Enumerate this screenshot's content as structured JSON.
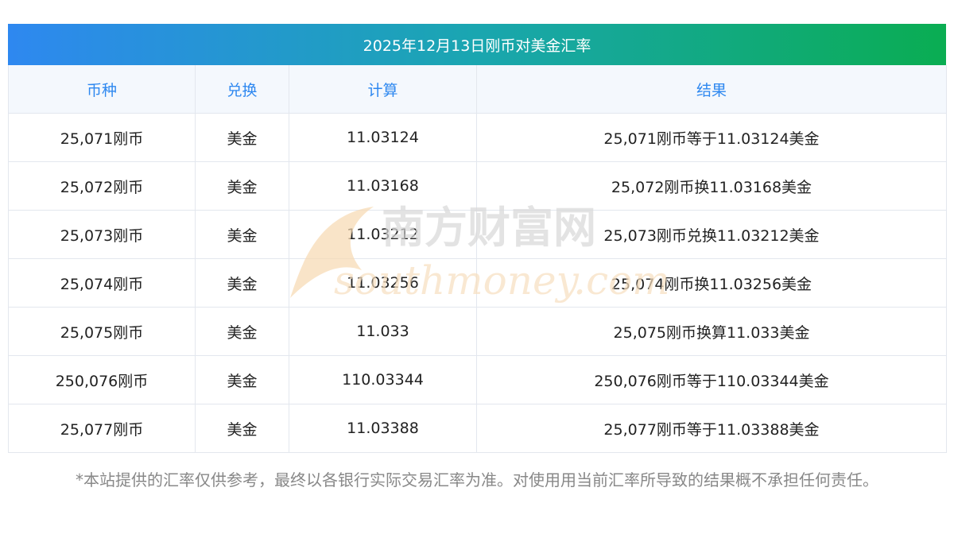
{
  "title": "2025年12月13日刚币对美金汇率",
  "columns": [
    "币种",
    "兑换",
    "计算",
    "结果"
  ],
  "rows": [
    {
      "currency": "25,071刚币",
      "target": "美金",
      "value": "11.03124",
      "result": "25,071刚币等于11.03124美金"
    },
    {
      "currency": "25,072刚币",
      "target": "美金",
      "value": "11.03168",
      "result": "25,072刚币换11.03168美金"
    },
    {
      "currency": "25,073刚币",
      "target": "美金",
      "value": "11.03212",
      "result": "25,073刚币兑换11.03212美金"
    },
    {
      "currency": "25,074刚币",
      "target": "美金",
      "value": "11.03256",
      "result": "25,074刚币换11.03256美金"
    },
    {
      "currency": "25,075刚币",
      "target": "美金",
      "value": "11.033",
      "result": "25,075刚币换算11.033美金"
    },
    {
      "currency": "250,076刚币",
      "target": "美金",
      "value": "110.03344",
      "result": "250,076刚币等于110.03344美金"
    },
    {
      "currency": "25,077刚币",
      "target": "美金",
      "value": "11.03388",
      "result": "25,077刚币等于11.03388美金"
    }
  ],
  "disclaimer": "*本站提供的汇率仅供参考，最终以各银行实际交易汇率为准。对使用用当前汇率所导致的结果概不承担任何责任。",
  "watermark": {
    "cn": "南方财富网",
    "en": "southmoney.com"
  },
  "colors": {
    "header_text": "#2e88f0",
    "gradient_start": "#2e88f0",
    "gradient_end": "#0aad52"
  }
}
